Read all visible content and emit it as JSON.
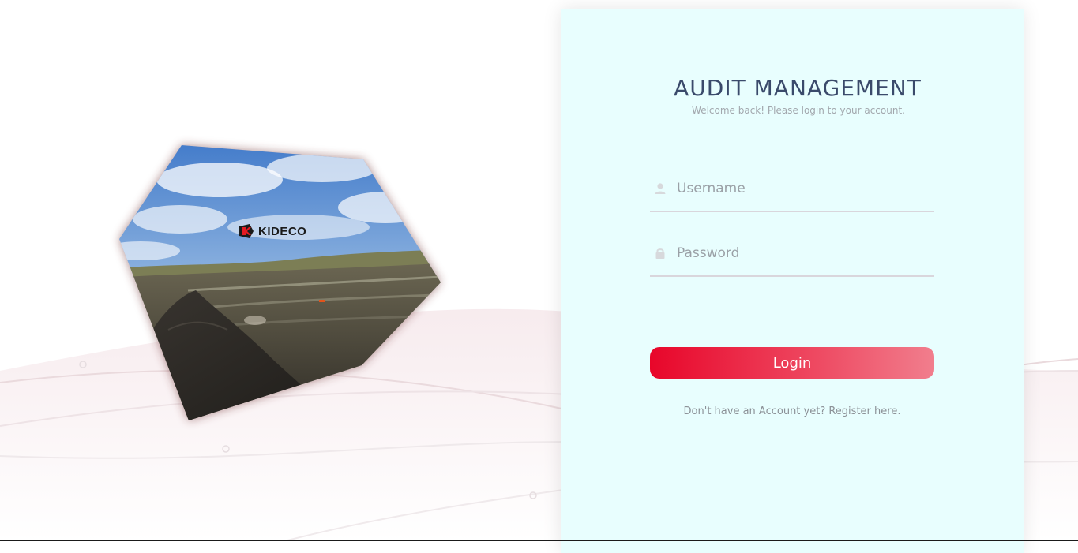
{
  "brand": {
    "logo_text": "KIDECO"
  },
  "login": {
    "title": "AUDIT MANAGEMENT",
    "subtitle": "Welcome back! Please login to your account.",
    "username_placeholder": "Username",
    "password_placeholder": "Password",
    "login_label": "Login",
    "register_text": "Don't have an Account yet? Register here."
  },
  "icons": {
    "username": "user-icon",
    "password": "lock-icon"
  },
  "colors": {
    "panel_background": "#e8fefe",
    "title": "#3a4a6b",
    "button_start": "#e8062a",
    "button_end": "#f17e8d",
    "brand_red": "#e31b23"
  }
}
